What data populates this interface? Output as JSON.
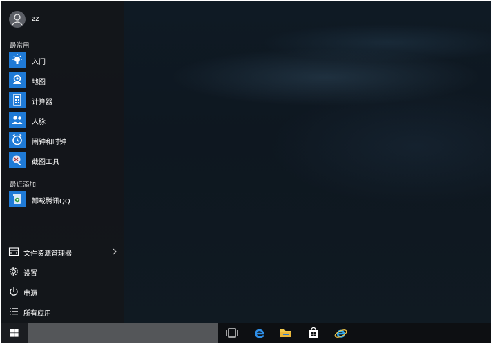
{
  "user": {
    "name": "zz"
  },
  "sections": {
    "most_used": "最常用",
    "recently_added": "最近添加"
  },
  "most_used_apps": [
    {
      "label": "入门",
      "icon": "lightbulb-icon",
      "color": "#1f7ad6"
    },
    {
      "label": "地图",
      "icon": "map-icon",
      "color": "#1f7ad6"
    },
    {
      "label": "计算器",
      "icon": "calculator-icon",
      "color": "#1f7ad6"
    },
    {
      "label": "人脉",
      "icon": "people-icon",
      "color": "#1f7ad6"
    },
    {
      "label": "闹钟和时钟",
      "icon": "alarm-clock-icon",
      "color": "#1f7ad6"
    },
    {
      "label": "截图工具",
      "icon": "snipping-tool-icon",
      "color": "#1f7ad6"
    }
  ],
  "recent_apps": [
    {
      "label": "卸载腾讯QQ",
      "icon": "uninstall-qq-icon",
      "color": "#1f7ad6"
    }
  ],
  "system_items": [
    {
      "label": "文件资源管理器",
      "icon": "file-explorer-icon"
    },
    {
      "label": "设置",
      "icon": "settings-gear-icon"
    },
    {
      "label": "电源",
      "icon": "power-icon"
    },
    {
      "label": "所有应用",
      "icon": "all-apps-list-icon"
    }
  ],
  "taskbar": {
    "icons": [
      "task-view-icon",
      "edge-icon",
      "file-explorer-icon",
      "store-icon",
      "internet-explorer-icon"
    ]
  },
  "colors": {
    "accent": "#1f7ad6",
    "menu_background": "#16181c",
    "taskbar_background": "#0d0f12",
    "search_box": "#545659"
  }
}
